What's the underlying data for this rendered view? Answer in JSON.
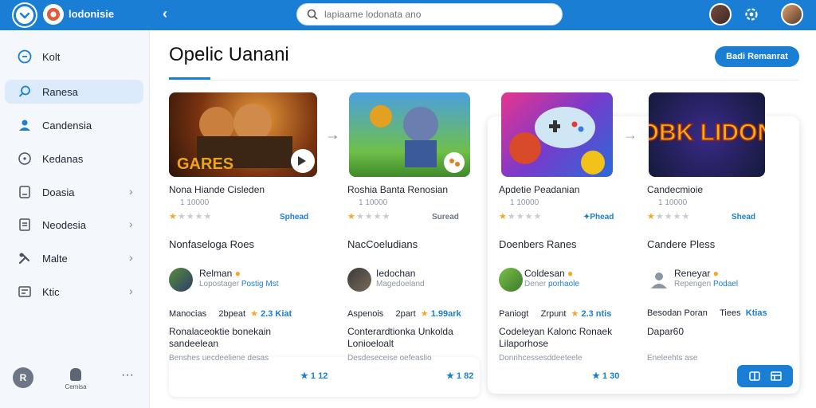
{
  "app": {
    "brand": "lodonisie"
  },
  "search": {
    "placeholder": "lapiaame lodonata ano"
  },
  "sidebar": {
    "items": [
      {
        "label": "Kolt",
        "icon": "home-icon"
      },
      {
        "label": "Ranesa",
        "icon": "search-icon"
      },
      {
        "label": "Candensia",
        "icon": "user-icon"
      },
      {
        "label": "Kedanas",
        "icon": "chat-icon"
      },
      {
        "label": "Doasia",
        "icon": "folder-icon"
      },
      {
        "label": "Neodesia",
        "icon": "document-icon"
      },
      {
        "label": "Malte",
        "icon": "tools-icon"
      },
      {
        "label": "Ktic",
        "icon": "list-icon"
      }
    ],
    "footer": {
      "avatar_letter": "R",
      "mid_label": "Cemisa"
    }
  },
  "page": {
    "title": "Opelic Uanani",
    "primary_button": "Badi Remanrat"
  },
  "games": [
    {
      "title": "Nona Hiande Cisleden",
      "sub": "1 10000",
      "rating": 1,
      "tag": "Sphead",
      "section": "Nonfaseloga Roes",
      "person": "Relman",
      "role_a": "Lopostager",
      "role_b": "Postig Mst",
      "meta_a": "Manocias",
      "meta_b": "2bpeat",
      "meta_rate": "2.3 Kiat",
      "desc": "Ronalaceoktie bonekain sandeelean",
      "note": "Benshes uecdeeliene desas",
      "foot": "1 12",
      "thumb_text": "GARES"
    },
    {
      "title": "Roshia Banta Renosian",
      "sub": "1 10000",
      "rating": 1,
      "tag": "Suread",
      "section": "NacCoeludians",
      "person": "Iedochan",
      "role_a": "Magedoeland",
      "role_b": "",
      "meta_a": "Aspenois",
      "meta_b": "2part",
      "meta_rate": "1.99ark",
      "desc": "Conterardtionka Unkolda Lonioeloalt",
      "note": "Desdeseceise oefeaslio",
      "foot": "1 82",
      "thumb_text": ""
    },
    {
      "title": "Apdetie Peadanian",
      "sub": "1 10000",
      "rating": 1,
      "tag": "Phead",
      "section": "Doenbers Ranes",
      "person": "Coldesan",
      "role_a": "Dener",
      "role_b": "porhaole",
      "meta_a": "Paniogt",
      "meta_b": "Zrpunt",
      "meta_rate": "2.3 ntis",
      "desc": "Codeleyan Kalonc Ronaek Lilaporhose",
      "note": "Donrihcessesddeeteele",
      "foot": "1 30",
      "thumb_text": ""
    },
    {
      "title": "Candecmioie",
      "sub": "1 10000",
      "rating": 1,
      "tag": "Shead",
      "section": "Candere Pless",
      "person": "Reneyar",
      "role_a": "Repengen",
      "role_b": "Podael",
      "meta_a": "Besodan Poran",
      "meta_b": "Tiees",
      "meta_rate": "Ktias",
      "desc": "Dapar60",
      "note": "Eneleehts ase",
      "foot": "",
      "thumb_text": "BOBK LIDONS"
    }
  ],
  "colors": {
    "accent": "#1a7fd4",
    "star": "#f5a623"
  }
}
